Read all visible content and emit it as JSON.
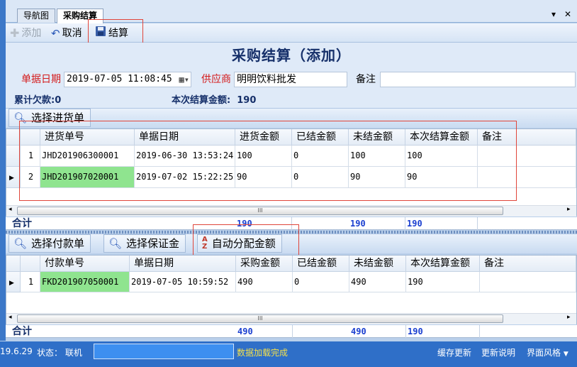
{
  "tabs": [
    {
      "label": "导航图"
    },
    {
      "label": "采购结算"
    }
  ],
  "window_controls": {
    "dropdown": "▾",
    "close": "✕"
  },
  "toolbar": {
    "add_label": "添加",
    "cancel_label": "取消",
    "settle_label": "结算"
  },
  "form": {
    "title": "采购结算（添加）",
    "date_label": "单据日期",
    "date_value": "2019-07-05 11:08:45",
    "supplier_label": "供应商",
    "supplier_value": "明明饮料批发",
    "remark_label": "备注",
    "remark_value": "",
    "debt_label": "累计欠款:",
    "debt_value": "0",
    "settle_amount_label": "本次结算金额:",
    "settle_amount_value": "190"
  },
  "purchase_section": {
    "select_button": "选择进货单",
    "columns": [
      "进货单号",
      "单据日期",
      "进货金额",
      "已结金额",
      "未结金额",
      "本次结算金额",
      "备注"
    ],
    "rows": [
      {
        "num": "1",
        "cells": [
          "JHD201906300001",
          "2019-06-30 13:53:24",
          "100",
          "0",
          "100",
          "100",
          ""
        ]
      },
      {
        "num": "2",
        "cells": [
          "JHD201907020001",
          "2019-07-02 15:22:25",
          "90",
          "0",
          "90",
          "90",
          ""
        ]
      }
    ],
    "total_label": "合计",
    "totals": [
      "190",
      "190",
      "190"
    ],
    "scroll_grip": "III"
  },
  "payment_section": {
    "select_payment_button": "选择付款单",
    "select_deposit_button": "选择保证金",
    "auto_allocate_button": "自动分配金额",
    "columns": [
      "付款单号",
      "单据日期",
      "采购金额",
      "已结金额",
      "未结金额",
      "本次结算金额",
      "备注"
    ],
    "rows": [
      {
        "num": "1",
        "cells": [
          "FKD201907050001",
          "2019-07-05 10:59:52",
          "490",
          "0",
          "490",
          "190",
          ""
        ]
      }
    ],
    "total_label": "合计",
    "totals": [
      "490",
      "490",
      "190"
    ],
    "scroll_grip": "III"
  },
  "statusbar": {
    "version": "19.6.29",
    "status_label": "状态：",
    "status_value": "联机",
    "message": "数据加载完成",
    "cache_update": "缓存更新",
    "update_notes": "更新说明",
    "ui_style": "界面风格"
  },
  "colors": {
    "accent": "#2f6fc8",
    "highlight_red": "#e0453a",
    "selected_cell": "#8fe48f",
    "total_blue": "#1a3fd0",
    "status_message": "#f5e04a"
  }
}
